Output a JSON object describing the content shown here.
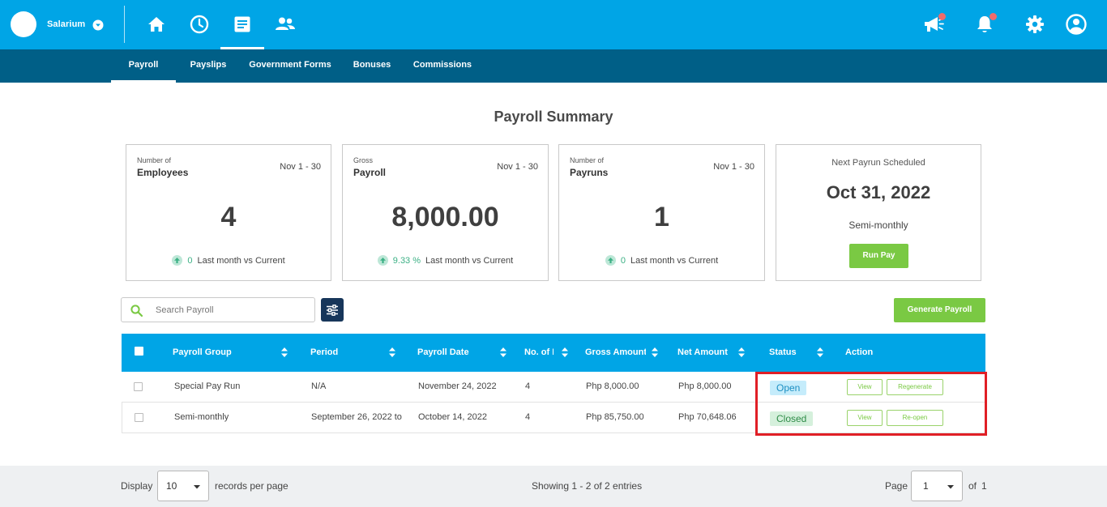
{
  "topbar": {
    "brand": "Salarium",
    "nav_icons": [
      "home-icon",
      "clock-icon",
      "document-icon",
      "people-icon"
    ],
    "right_icons": [
      "megaphone-icon",
      "bell-icon",
      "gear-icon",
      "user-icon"
    ]
  },
  "subnav": {
    "tabs": [
      {
        "label": "Payroll",
        "active": true
      },
      {
        "label": "Payslips",
        "active": false
      },
      {
        "label": "Government Forms",
        "active": false
      },
      {
        "label": "Bonuses",
        "active": false
      },
      {
        "label": "Commissions",
        "active": false
      }
    ]
  },
  "page_title": "Payroll Summary",
  "cards": [
    {
      "small": "Number of",
      "label": "Employees",
      "range": "Nov 1 - 30",
      "value": "4",
      "change": "0",
      "change_text": "Last month vs Current"
    },
    {
      "small": "Gross",
      "label": "Payroll",
      "range": "Nov 1 - 30",
      "value": "8,000.00",
      "change": "9.33 %",
      "change_text": "Last month vs Current"
    },
    {
      "small": "Number of",
      "label": "Payruns",
      "range": "Nov 1 - 30",
      "value": "1",
      "change": "0",
      "change_text": "Last month vs Current"
    }
  ],
  "next_payrun": {
    "label": "Next Payrun Scheduled",
    "date": "Oct 31, 2022",
    "frequency": "Semi-monthly",
    "button": "Run Pay"
  },
  "search": {
    "placeholder": "Search Payroll"
  },
  "generate_button": "Generate Payroll",
  "table": {
    "headers": [
      "Payroll Group",
      "Period",
      "Payroll Date",
      "No. of E",
      "Gross Amount",
      "Net Amount",
      "Status",
      "Action"
    ],
    "rows": [
      {
        "group": "Special Pay Run",
        "period": "N/A",
        "date": "November 24, 2022",
        "count": "4",
        "gross": "Php 8,000.00",
        "net": "Php 8,000.00",
        "status": "Open",
        "actions": [
          "View",
          "Regenerate"
        ]
      },
      {
        "group": "Semi-monthly",
        "period": "September 26, 2022 to",
        "date": "October 14, 2022",
        "count": "4",
        "gross": "Php 85,750.00",
        "net": "Php 70,648.06",
        "status": "Closed",
        "actions": [
          "View",
          "Re-open"
        ]
      }
    ]
  },
  "footer": {
    "display_label": "Display",
    "per_page": "10",
    "per_page_label": "records per page",
    "showing": "Showing 1 - 2 of 2 entries",
    "page_label": "Page",
    "page": "1",
    "of_label": "of",
    "total_pages": "1"
  },
  "colors": {
    "topbar": "#00a5e6",
    "subnav": "#005f87",
    "table_header": "#00a5e6",
    "primary_green": "#7ac943",
    "highlight_red": "#e01f26",
    "filter_button": "#17365a"
  }
}
